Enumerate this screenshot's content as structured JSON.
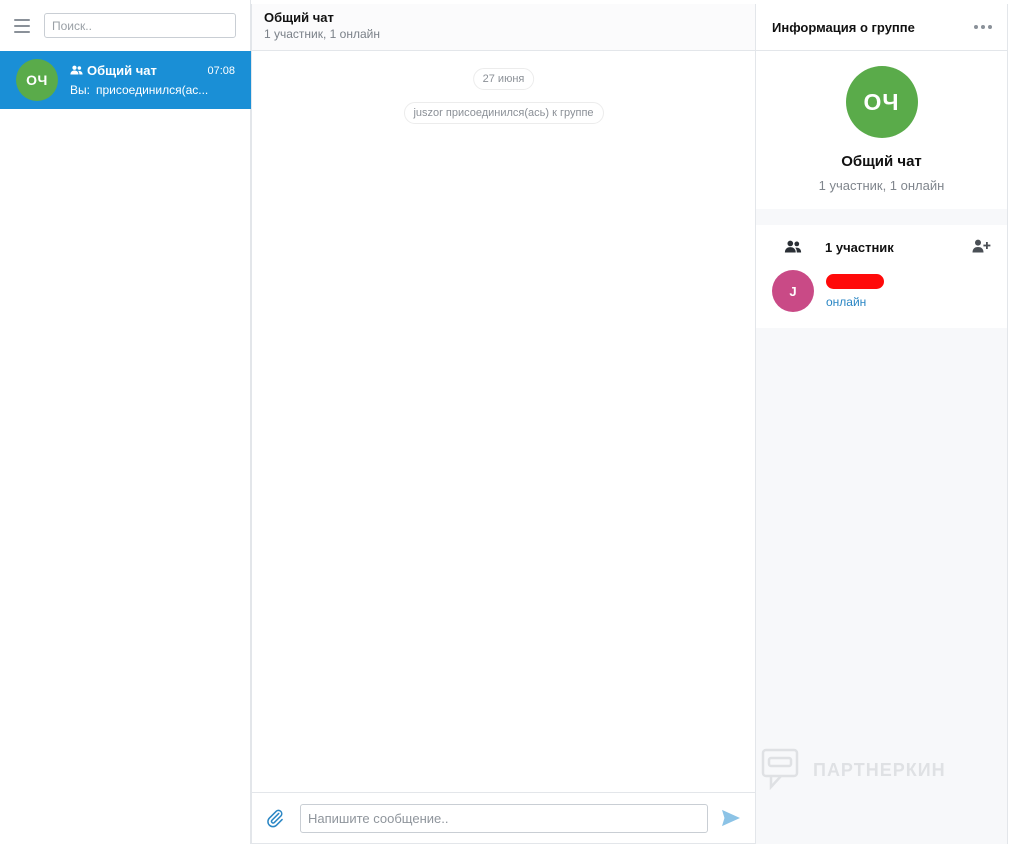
{
  "sidebar": {
    "search_placeholder": "Поиск..",
    "chats": [
      {
        "avatar_initials": "ОЧ",
        "avatar_color": "#5aab4a",
        "name": "Общий чат",
        "time": "07:08",
        "preview_prefix": "Вы:",
        "preview_text": "присоединился(ас...",
        "selected_color": "#1a8fd6",
        "icon": "group-icon"
      }
    ]
  },
  "main": {
    "title": "Общий чат",
    "subtitle": "1 участник, 1 онлайн",
    "date_label": "27 июня",
    "system_message": "juszor присоединился(ась) к группе",
    "composer": {
      "placeholder": "Напишите сообщение..",
      "attach_icon": "paperclip-icon",
      "send_icon": "send-icon"
    }
  },
  "info_panel": {
    "title": "Информация о группе",
    "menu_icon": "more-icon",
    "group": {
      "initials": "ОЧ",
      "name": "Общий чат",
      "status": "1 участник, 1 онлайн"
    },
    "members": {
      "count_label": "1 участник",
      "icon": "members-icon",
      "add_icon": "add-member-icon",
      "list": [
        {
          "initial": "J",
          "color": "#c94a86",
          "status": "онлайн"
        }
      ]
    },
    "watermark": "ПАРТНЕРКИН"
  }
}
